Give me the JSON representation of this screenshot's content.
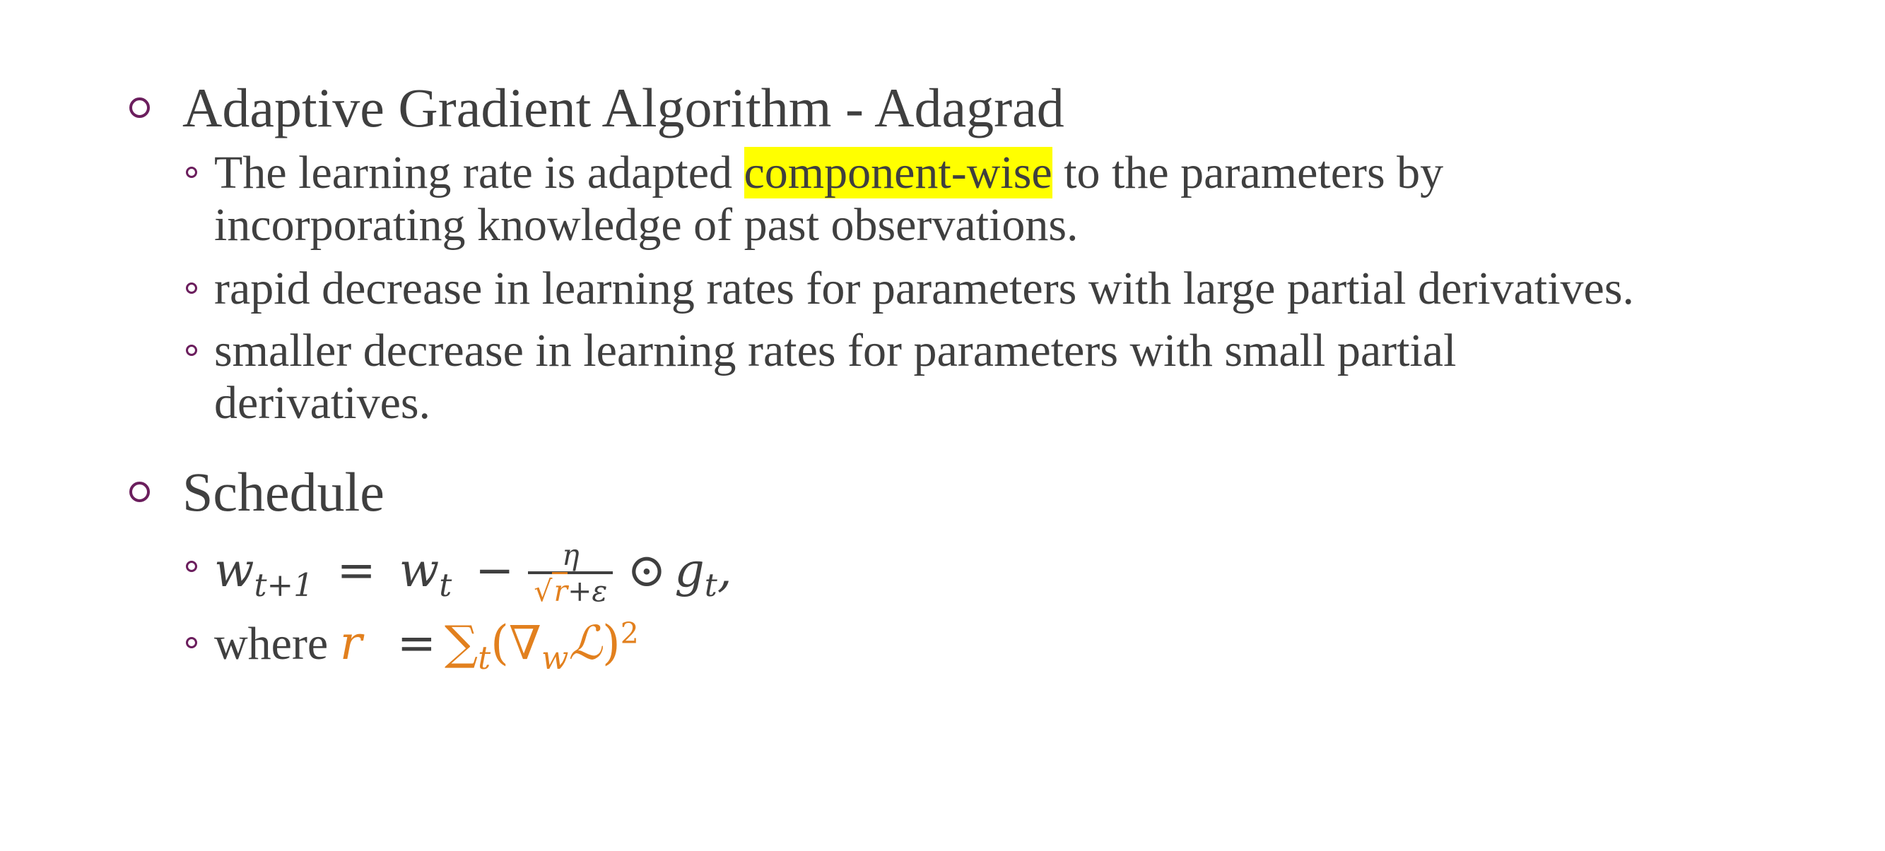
{
  "sections": [
    {
      "title": "Adaptive Gradient Algorithm - Adagrad",
      "bullets": [
        {
          "before": "The learning rate is adapted ",
          "highlight": "component-wise",
          "after": " to the parameters by",
          "line2": "incorporating knowledge of past observations."
        },
        {
          "text": "rapid decrease in learning rates for parameters with large partial derivatives."
        },
        {
          "line1": "smaller decrease in learning rates for parameters with small partial",
          "line2": "derivatives."
        }
      ]
    },
    {
      "title": "Schedule",
      "formula1": {
        "w": "w",
        "sub_t1": "t+1",
        "equals": "=",
        "sub_t": "t",
        "minus": "−",
        "eta": "η",
        "sqrt": "√",
        "r": "r",
        "plus_eps": "+ε",
        "odot": "⊙",
        "g": "g",
        "comma": ","
      },
      "formula2": {
        "where": "where",
        "r": "r",
        "equals": "=",
        "sum": "∑",
        "sub_t": "t",
        "paren_open": "(",
        "nabla": "∇",
        "sub_w": "w",
        "loss": "ℒ",
        "paren_close": ")",
        "power": "2"
      }
    }
  ],
  "colors": {
    "text": "#3f3f3f",
    "bullet": "#6b1e5d",
    "highlight": "#ffff00",
    "accent": "#e2801e"
  }
}
